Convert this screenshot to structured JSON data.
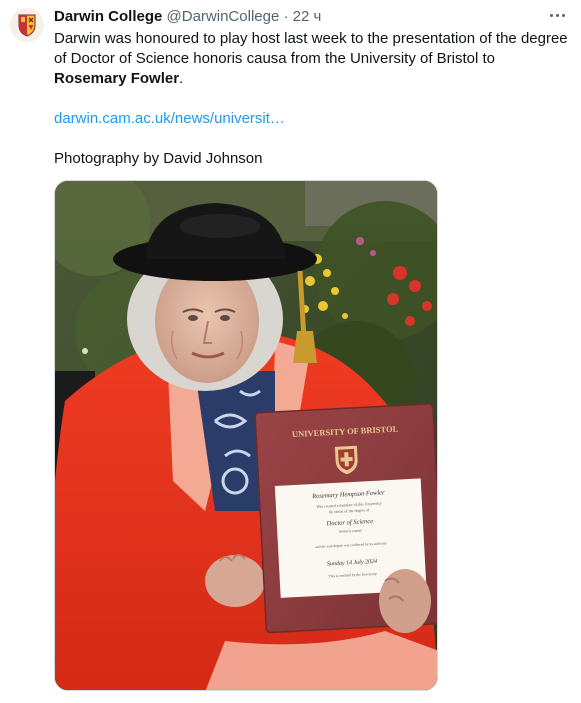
{
  "tweet": {
    "author_name": "Darwin College",
    "author_handle": "@DarwinCollege",
    "separator": "·",
    "time": "22 ч",
    "text_part1": "Darwin was honoured to play host last week to the presentation of the degree of Doctor of Science honoris causa from the University of Bristol to ",
    "text_bold": "Rosemary Fowler",
    "text_part2": ".",
    "link": "darwin.cam.ac.uk/news/universit…",
    "credit": "Photography by David Johnson"
  },
  "certificate": {
    "university": "UNIVERSITY OF BRISTOL",
    "recipient": "Rosemary Hempson Fowler",
    "line1": "Was created a member of this University",
    "line2": "by virtue of the degree of",
    "degree": "Doctor of Science",
    "honoris": "honoris causa",
    "line3": "and the said degree was conferred by its authority",
    "date": "Sunday 14 July 2024",
    "line4": "This is certified by the University"
  },
  "colors": {
    "link": "#1d9bf0",
    "secondary_text": "#536471",
    "robe": "#e8331c",
    "folder": "#8e3d3f"
  },
  "icons": {
    "avatar": "college-crest-icon",
    "more": "more-options-icon"
  }
}
